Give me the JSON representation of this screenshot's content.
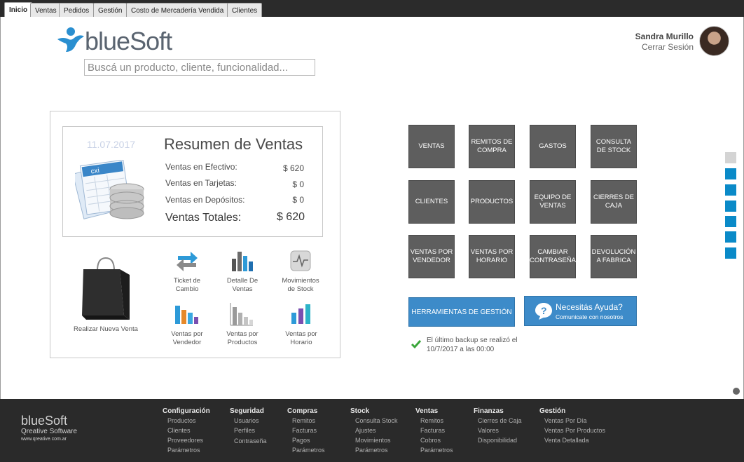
{
  "tabs": [
    "Inicio",
    "Ventas",
    "Pedidos",
    "Gestión",
    "Costo de Mercadería Vendida",
    "Clientes"
  ],
  "header": {
    "logo_text": "blueSoft",
    "search_placeholder": "Buscá un producto, cliente, funcionalidad...",
    "user_name": "Sandra Murillo",
    "logout": "Cerrar Sesión"
  },
  "summary": {
    "date": "11.07.2017",
    "title": "Resumen de Ventas",
    "rows": [
      {
        "label": "Ventas en Efectivo:",
        "value": "$ 620"
      },
      {
        "label": "Ventas en Tarjetas:",
        "value": "$ 0"
      },
      {
        "label": "Ventas en Depósitos:",
        "value": "$ 0"
      }
    ],
    "total_label": "Ventas Totales:",
    "total_value": "$ 620",
    "cxi_label": "cxi"
  },
  "actions": {
    "new_sale": "Realizar Nueva Venta",
    "ticket": "Ticket de Cambio",
    "sales_detail": "Detalle De Ventas",
    "stock_moves": "Movimientos de Stock",
    "by_seller": "Ventas por Vendedor",
    "by_product": "Ventas por Productos",
    "by_hour": "Ventas por Horario"
  },
  "tiles": [
    "VENTAS",
    "REMITOS DE COMPRA",
    "GASTOS",
    "CONSULTA DE STOCK",
    "CLIENTES",
    "PRODUCTOS",
    "EQUIPO DE VENTAS",
    "CIERRES DE CAJA",
    "VENTAS POR VENDEDOR",
    "VENTAS POR HORARIO",
    "CAMBIAR CONTRASEÑA",
    "DEVOLUCIÓN A FABRICA"
  ],
  "tools_button": "HERRAMIENTAS DE GESTIÓN",
  "help": {
    "title": "Necesitás Ayuda?",
    "subtitle": "Comunicate con nosotros"
  },
  "backup": {
    "line1": "El último backup se realizó el",
    "line2": "10/7/2017 a las 00:00"
  },
  "footer": {
    "brand": "blueSoft",
    "company": "Qreative Software",
    "url": "www.qreative.com.ar",
    "columns": [
      {
        "title": "Configuración",
        "items": [
          "Productos",
          "Clientes",
          "Proveedores",
          "Parámetros"
        ]
      },
      {
        "title": "Seguridad",
        "items": [
          "Usuarios",
          "Perfiles",
          "Contraseña"
        ]
      },
      {
        "title": "Compras",
        "items": [
          "Remitos",
          "Facturas",
          "Pagos",
          "Parámetros"
        ]
      },
      {
        "title": "Stock",
        "items": [
          "Consulta Stock",
          "Ajustes",
          "Movimientos",
          "Parámetros"
        ]
      },
      {
        "title": "Ventas",
        "items": [
          "Remitos",
          "Facturas",
          "Cobros",
          "Parámetros"
        ]
      },
      {
        "title": "Finanzas",
        "items": [
          "Cierres de Caja",
          "Valores",
          "Disponibilidad"
        ]
      },
      {
        "title": "Gestión",
        "items": [
          "Ventas Por Día",
          "Ventas Por Productos",
          "Venta Detallada"
        ]
      }
    ]
  },
  "colors": {
    "accent": "#3d8bc9",
    "tile": "#5e5e5e",
    "side": "#0a8ac8"
  }
}
